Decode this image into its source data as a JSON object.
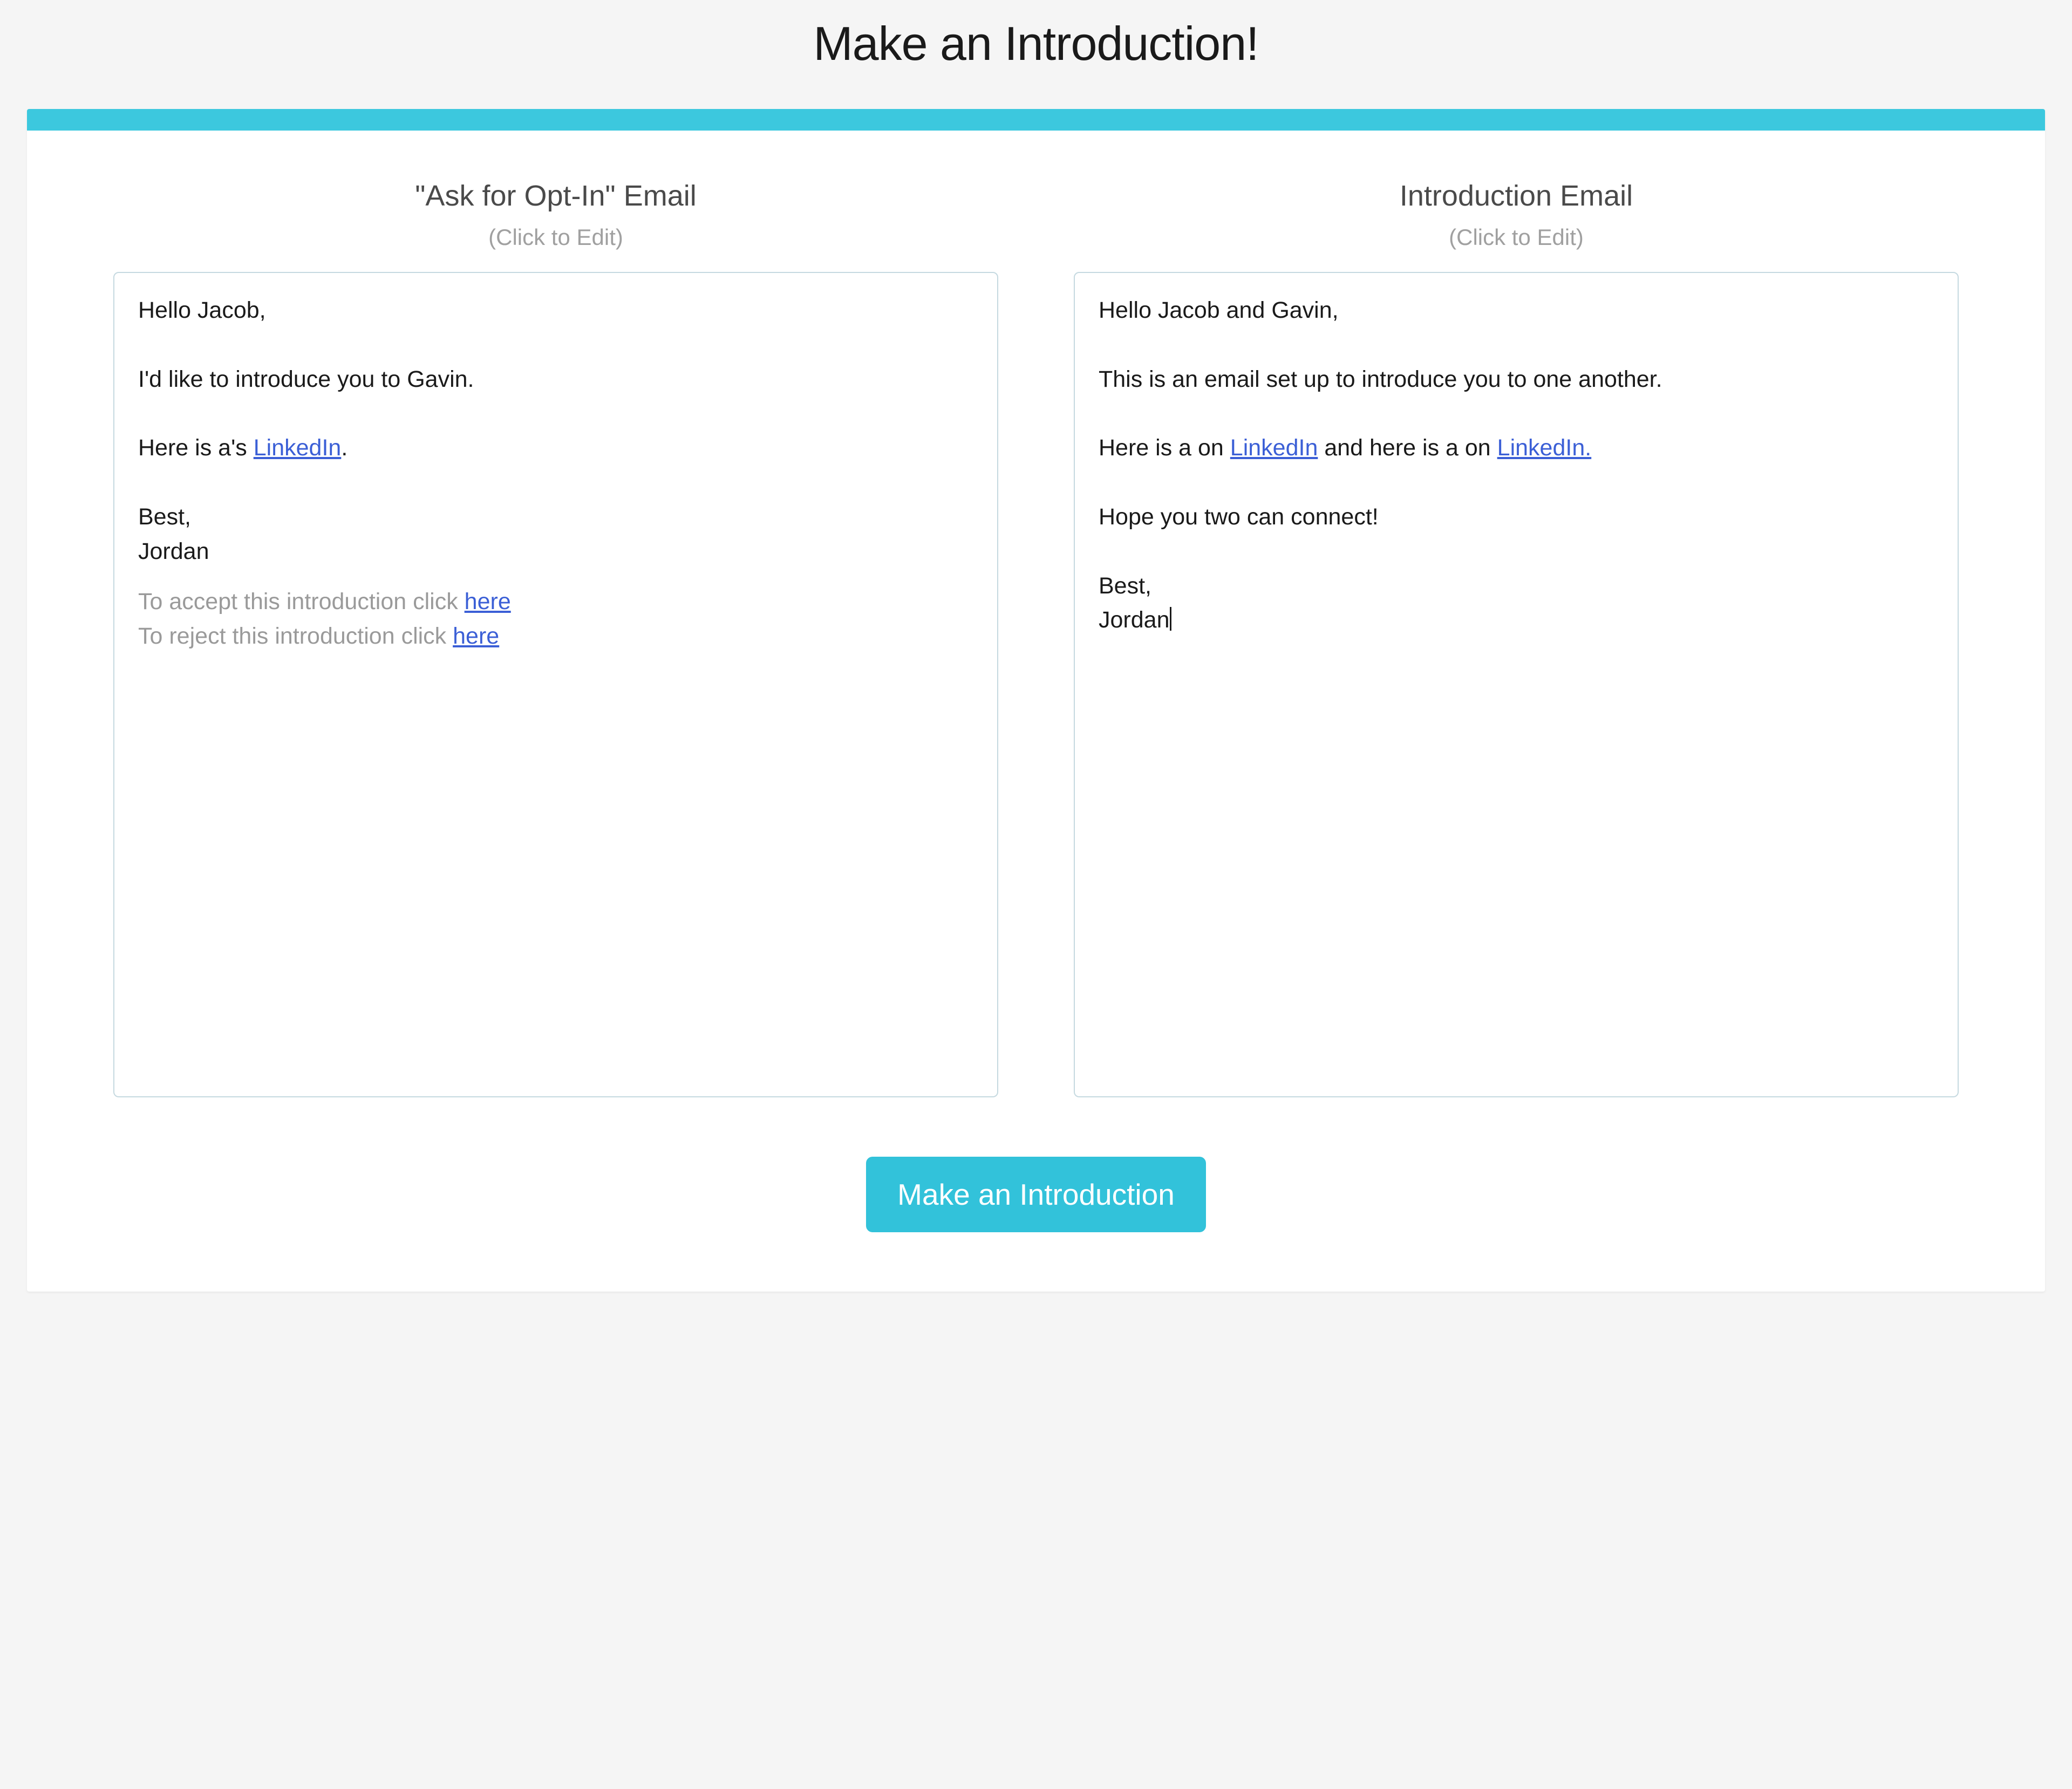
{
  "pageTitle": "Make an Introduction!",
  "columns": {
    "left": {
      "title": "\"Ask for Opt-In\" Email",
      "subtitle": "(Click to Edit)",
      "body": {
        "greeting": "Hello Jacob,",
        "line1": "I'd like to introduce you to Gavin.",
        "line2_prefix": "Here is a's ",
        "line2_link": "LinkedIn",
        "line2_suffix": ".",
        "closing1": "Best,",
        "closing2": "Jordan",
        "accept_prefix": "To accept this introduction click ",
        "accept_link": "here",
        "reject_prefix": "To reject this introduction click ",
        "reject_link": "here"
      }
    },
    "right": {
      "title": "Introduction Email",
      "subtitle": "(Click to Edit)",
      "body": {
        "greeting": "Hello Jacob and Gavin,",
        "line1": "This is an email set up to introduce you to one another.",
        "line2_prefix": "Here is a on ",
        "line2_link1": "LinkedIn",
        "line2_mid": " and here is a on ",
        "line2_link2": "LinkedIn.",
        "line3": "Hope you two can connect!",
        "closing1": "Best,",
        "closing2": "Jordan"
      }
    }
  },
  "button": {
    "label": "Make an Introduction"
  }
}
